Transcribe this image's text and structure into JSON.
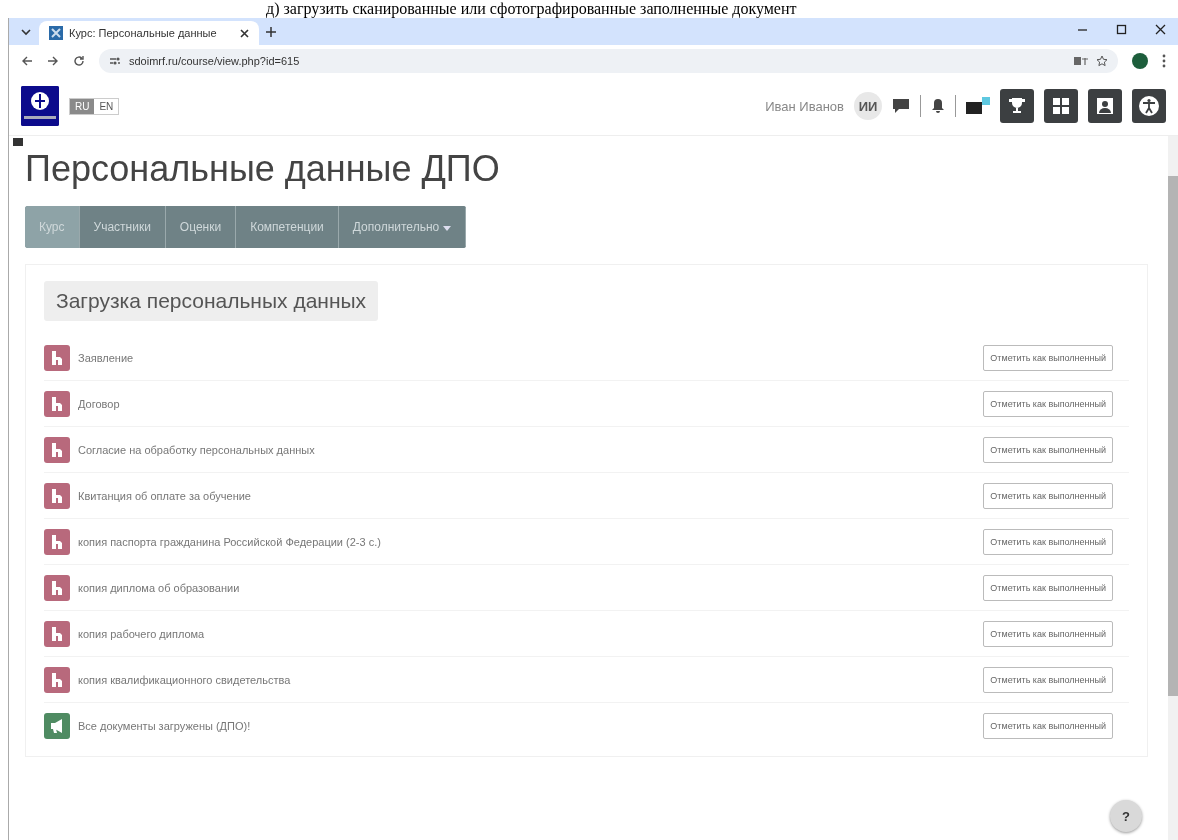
{
  "caption": "д) загрузить сканированные или сфотографированные заполненные документ",
  "browser": {
    "tab_title": "Курс: Персональные данные",
    "url": "sdoimrf.ru/course/view.php?id=615"
  },
  "header": {
    "languages": [
      {
        "label": "RU",
        "selected": true
      },
      {
        "label": "EN",
        "selected": false
      }
    ],
    "user_name": "Иван Иванов",
    "avatar_initials": "ИИ"
  },
  "course_title": "Персональные данные ДПО",
  "nav_tabs": [
    {
      "label": "Курс",
      "selected": true,
      "dropdown": false
    },
    {
      "label": "Участники",
      "selected": false,
      "dropdown": false
    },
    {
      "label": "Оценки",
      "selected": false,
      "dropdown": false
    },
    {
      "label": "Компетенции",
      "selected": false,
      "dropdown": false
    },
    {
      "label": "Дополнительно",
      "selected": false,
      "dropdown": true
    }
  ],
  "section_title": "Загрузка персональных данных",
  "activities": [
    {
      "kind": "assign",
      "name": "Заявление",
      "button": "Отметить как выполненный"
    },
    {
      "kind": "assign",
      "name": "Договор",
      "button": "Отметить как выполненный"
    },
    {
      "kind": "assign",
      "name": "Согласие на обработку персональных данных",
      "button": "Отметить как выполненный"
    },
    {
      "kind": "assign",
      "name": "Квитанция об оплате за обучение",
      "button": "Отметить как выполненный"
    },
    {
      "kind": "assign",
      "name": "копия паспорта гражданина Российской Федерации (2-3 с.)",
      "button": "Отметить как выполненный"
    },
    {
      "kind": "assign",
      "name": "копия диплома об образовании",
      "button": "Отметить как выполненный"
    },
    {
      "kind": "assign",
      "name": "копия рабочего диплома",
      "button": "Отметить как выполненный"
    },
    {
      "kind": "assign",
      "name": "копия квалификационного свидетельства",
      "button": "Отметить как выполненный"
    },
    {
      "kind": "forum",
      "name": "Все документы загружены (ДПО)!",
      "button": "Отметить как выполненный"
    }
  ],
  "help_button": "?"
}
